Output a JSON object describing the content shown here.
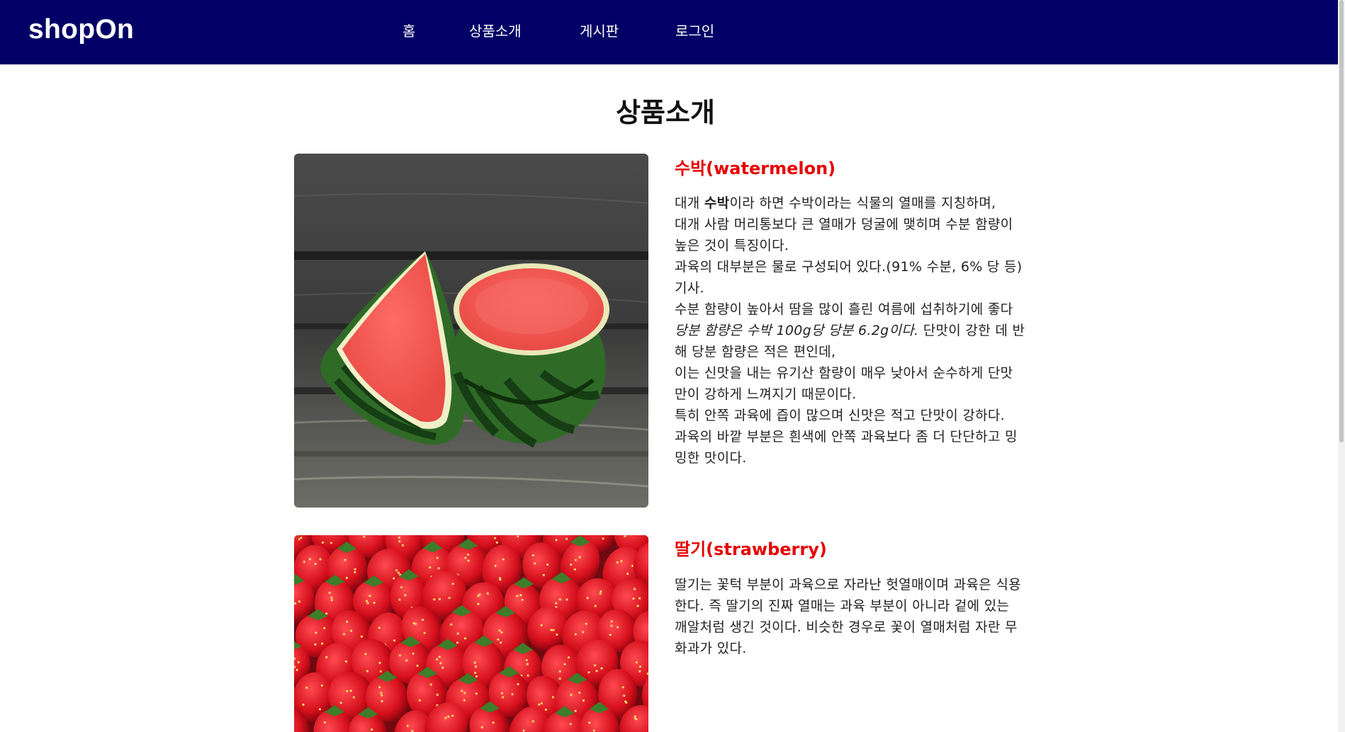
{
  "brand": {
    "logo": "shopOn",
    "nav_color": "#020066"
  },
  "nav": {
    "items": [
      {
        "label": "홈"
      },
      {
        "label": "상품소개"
      },
      {
        "label": "게시판"
      },
      {
        "label": "로그인"
      }
    ]
  },
  "main": {
    "title": "상품소개",
    "accent_color": "#e60000",
    "products": [
      {
        "name": "수박(watermelon)",
        "desc": {
          "l1a": "대개 ",
          "l1b": "수박",
          "l1c": "이라 하면 수박이라는 식물의 열매를 지칭하며,",
          "l2": "대개 사람 머리통보다 큰 열매가 덩굴에 맺히며 수분 함량이",
          "l3": "높은 것이 특징이다.",
          "l4": "과육의 대부분은 물로 구성되어 있다.(91% 수분, 6% 당 등)",
          "l5": "기사.",
          "l6": "수분 함량이 높아서 땀을 많이 흘린 여름에 섭취하기에 좋다",
          "l7a": "당분 함량은 수박 100g당 당분 6.2g이다.",
          "l7b": " 단맛이 강한 데 반",
          "l8": "해 당분 함량은 적은 편인데,",
          "l9": "이는 신맛을 내는 유기산 함량이 매우 낮아서 순수하게 단맛",
          "l10": "만이 강하게 느껴지기 때문이다.",
          "l11": "특히 안쪽 과육에 즙이 많으며 신맛은 적고 단맛이 강하다.",
          "l12": "과육의 바깥 부분은 흰색에 안쪽 과육보다 좀 더 단단하고 밍",
          "l13": "밍한 맛이다."
        }
      },
      {
        "name": "딸기(strawberry)",
        "desc": {
          "l1": "딸기는 꽃턱 부분이 과육으로 자라난 헛열매이며 과육은 식용",
          "l2": "한다. 즉 딸기의 진짜 열매는 과육 부분이 아니라 겉에 있는",
          "l3": "깨알처럼 생긴 것이다. 비슷한 경우로 꽃이 열매처럼 자란 무",
          "l4": "화과가 있다."
        }
      }
    ]
  }
}
